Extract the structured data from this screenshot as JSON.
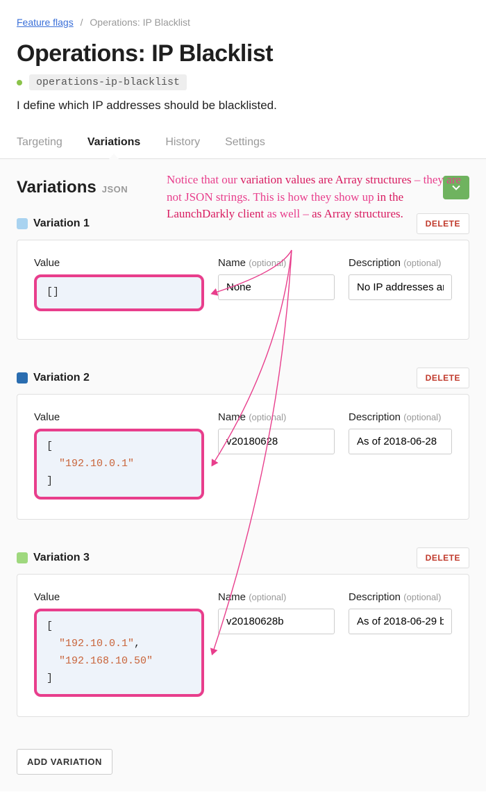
{
  "breadcrumb": {
    "root": "Feature flags",
    "current": "Operations: IP Blacklist"
  },
  "title": "Operations: IP Blacklist",
  "key": "operations-ip-blacklist",
  "description": "I define which IP addresses should be blacklisted.",
  "tabs": {
    "targeting": "Targeting",
    "variations": "Variations",
    "history": "History",
    "settings": "Settings"
  },
  "section": {
    "heading": "Variations",
    "badge": "JSON"
  },
  "labels": {
    "value": "Value",
    "name": "Name",
    "desc": "Description",
    "optional": "(optional)"
  },
  "buttons": {
    "delete": "DELETE",
    "add": "ADD VARIATION"
  },
  "variations": [
    {
      "label": "Variation 1",
      "code_html": "<span class='bracket'>[]</span>",
      "name": "None",
      "desc": "No IP addresses are blocked."
    },
    {
      "label": "Variation 2",
      "code_html": "<span class='bracket'>[</span>\n  <span class='str'>\"192.10.0.1\"</span>\n<span class='bracket'>]</span>",
      "name": "v20180628",
      "desc": "As of 2018-06-28"
    },
    {
      "label": "Variation 3",
      "code_html": "<span class='bracket'>[</span>\n  <span class='str'>\"192.10.0.1\"</span>,\n  <span class='str'>\"192.168.10.50\"</span>\n<span class='bracket'>]</span>",
      "name": "v20180628b",
      "desc": "As of 2018-06-29 b"
    }
  ],
  "annotation": {
    "t1": "Notice that our ",
    "h1": "variation values are Array structures",
    "t2": " – they are not JSON strings. This is how they show up ",
    "h2": "in the LaunchDarkly client",
    "t3": " as well – ",
    "h3": " as Array structures.",
    "t4": ""
  }
}
